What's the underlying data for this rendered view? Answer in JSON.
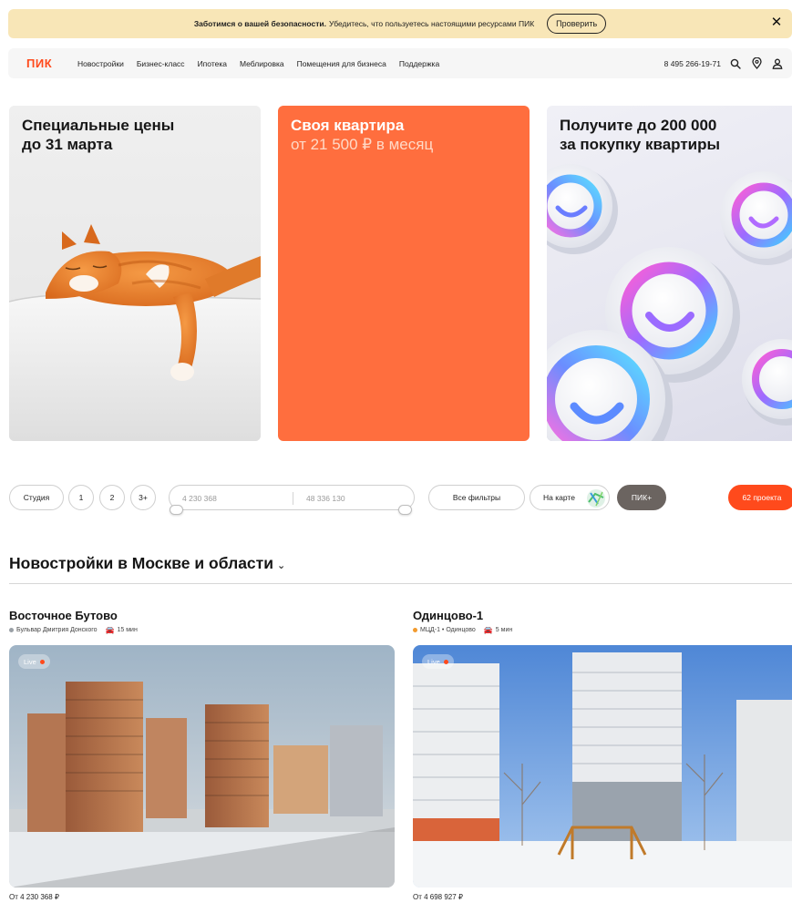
{
  "banner": {
    "bold_text": "Заботимся о вашей безопасности.",
    "text": "Убедитесь, что пользуетесь настоящими ресурсами ПИК",
    "check_button": "Проверить",
    "close": "✕"
  },
  "nav": {
    "logo": "ПИК",
    "menu": [
      "Новостройки",
      "Бизнес-класс",
      "Ипотека",
      "Меблировка",
      "Помещения для бизнеса",
      "Поддержка"
    ],
    "phone": "8 495 266-19-71"
  },
  "promos": [
    {
      "line1": "Специальные цены",
      "line2": "до 31 марта"
    },
    {
      "line1": "Своя квартира",
      "line2": "от 21 500 ₽ в месяц"
    },
    {
      "line1": "Получите до 200 000",
      "line2": "за покупку квартиры"
    }
  ],
  "filters": {
    "rooms": [
      "Студия",
      "1",
      "2",
      "3+"
    ],
    "price_from": "4 230 368",
    "price_to": "48 336 130",
    "all_filters": "Все фильтры",
    "on_map": "На карте",
    "pik_plus": "ПИК+",
    "projects": "62 проекта"
  },
  "section": {
    "title": "Новостройки в Москве и области",
    "chevron": "⌄"
  },
  "projects": [
    {
      "name": "Восточное Бутово",
      "station": "Бульвар Дмитрия Донского",
      "station_color": "#9aa0a6",
      "travel": "15 мин",
      "live": "Live",
      "price": "От 4 230 368 ₽"
    },
    {
      "name": "Одинцово-1",
      "station": "МЦД-1 • Одинцово",
      "station_color": "#f29a2e",
      "travel": "5 мин",
      "live": "Live",
      "price": "От 4 698 927 ₽"
    }
  ],
  "colors": {
    "brand": "#ff4a1c",
    "banner_bg": "#f8e6b7",
    "promo_orange": "#ff6e3e"
  }
}
